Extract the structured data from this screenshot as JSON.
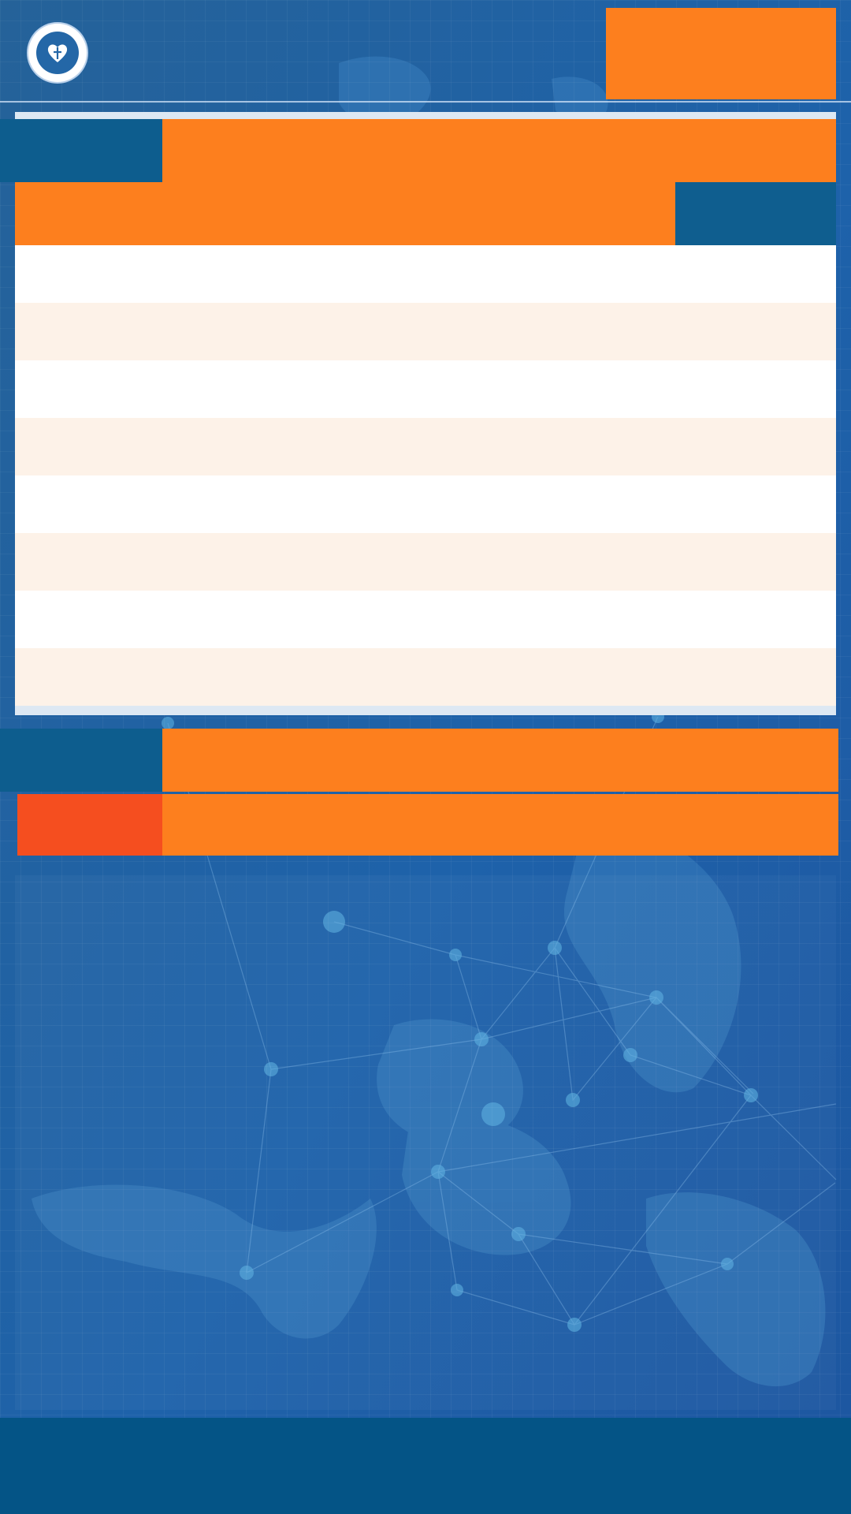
{
  "header": {
    "logo": "hospital-emblem",
    "banner_text": ""
  },
  "section1": {
    "tab_label": "",
    "title": ""
  },
  "table": {
    "header_left": "",
    "header_right": "",
    "rows": [
      {
        "name": "",
        "value": ""
      },
      {
        "name": "",
        "value": ""
      },
      {
        "name": "",
        "value": ""
      },
      {
        "name": "",
        "value": ""
      },
      {
        "name": "",
        "value": ""
      },
      {
        "name": "",
        "value": ""
      },
      {
        "name": "",
        "value": ""
      },
      {
        "name": "",
        "value": ""
      }
    ]
  },
  "section2": {
    "tab_label": "",
    "title": ""
  },
  "section3": {
    "tab_label": "",
    "title": ""
  },
  "footer": {
    "text": ""
  },
  "colors": {
    "accent_orange": "#fd7f1e",
    "accent_red": "#f54e1f",
    "brand_blue": "#0d5d8e",
    "footer_blue": "#045486",
    "row_alt": "#fdf2e8"
  }
}
